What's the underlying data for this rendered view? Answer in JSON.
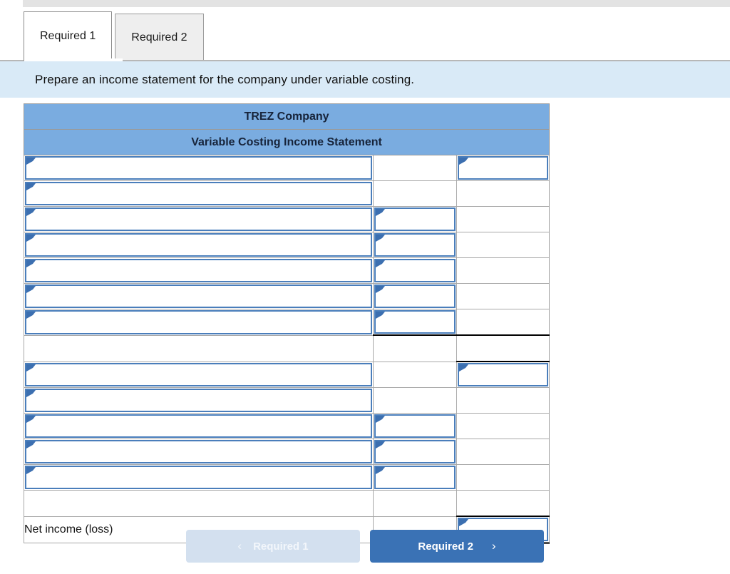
{
  "tabs": [
    {
      "label": "Required 1",
      "active": true
    },
    {
      "label": "Required 2",
      "active": false
    }
  ],
  "banner": {
    "text": "Prepare an income statement for the company under variable costing."
  },
  "statement": {
    "company_title": "TREZ  Company",
    "statement_title": "Variable Costing Income Statement",
    "columns": [
      "description",
      "amount-1",
      "amount-2"
    ],
    "rows": [
      {
        "label": "",
        "c1_input": true,
        "c2_input": false,
        "c3_input": true
      },
      {
        "label": "",
        "c1_input": true,
        "c2_input": false,
        "c3_input": false
      },
      {
        "label": "",
        "c1_input": true,
        "c2_input": true,
        "c3_input": false
      },
      {
        "label": "",
        "c1_input": true,
        "c2_input": true,
        "c3_input": false
      },
      {
        "label": "",
        "c1_input": true,
        "c2_input": true,
        "c3_input": false
      },
      {
        "label": "",
        "c1_input": true,
        "c2_input": true,
        "c3_input": false
      },
      {
        "label": "",
        "c1_input": true,
        "c2_input": true,
        "c3_input": false
      },
      {
        "label": "",
        "c1_input": false,
        "c2_input": false,
        "c3_input": false,
        "rule": "subtotal"
      },
      {
        "label": "",
        "c1_input": true,
        "c2_input": false,
        "c3_input": true
      },
      {
        "label": "",
        "c1_input": true,
        "c2_input": false,
        "c3_input": false
      },
      {
        "label": "",
        "c1_input": true,
        "c2_input": true,
        "c3_input": false
      },
      {
        "label": "",
        "c1_input": true,
        "c2_input": true,
        "c3_input": false
      },
      {
        "label": "",
        "c1_input": true,
        "c2_input": true,
        "c3_input": false
      },
      {
        "label": "",
        "c1_input": false,
        "c2_input": false,
        "c3_input": false
      },
      {
        "label": "Net income (loss)",
        "c1_input": false,
        "c2_input": false,
        "c3_input": true,
        "rule": "total"
      }
    ]
  },
  "nav": {
    "prev_label": "Required 1",
    "prev_icon": "chevron-left-icon",
    "prev_glyph": "‹",
    "prev_disabled": true,
    "next_label": "Required 2",
    "next_icon": "chevron-right-icon",
    "next_glyph": "›"
  },
  "colors": {
    "header_blue": "#7aace0",
    "input_border": "#4a7ebb",
    "banner_blue": "#d9eaf7",
    "next_button": "#3a72b5",
    "prev_button": "#d3e0ef"
  }
}
